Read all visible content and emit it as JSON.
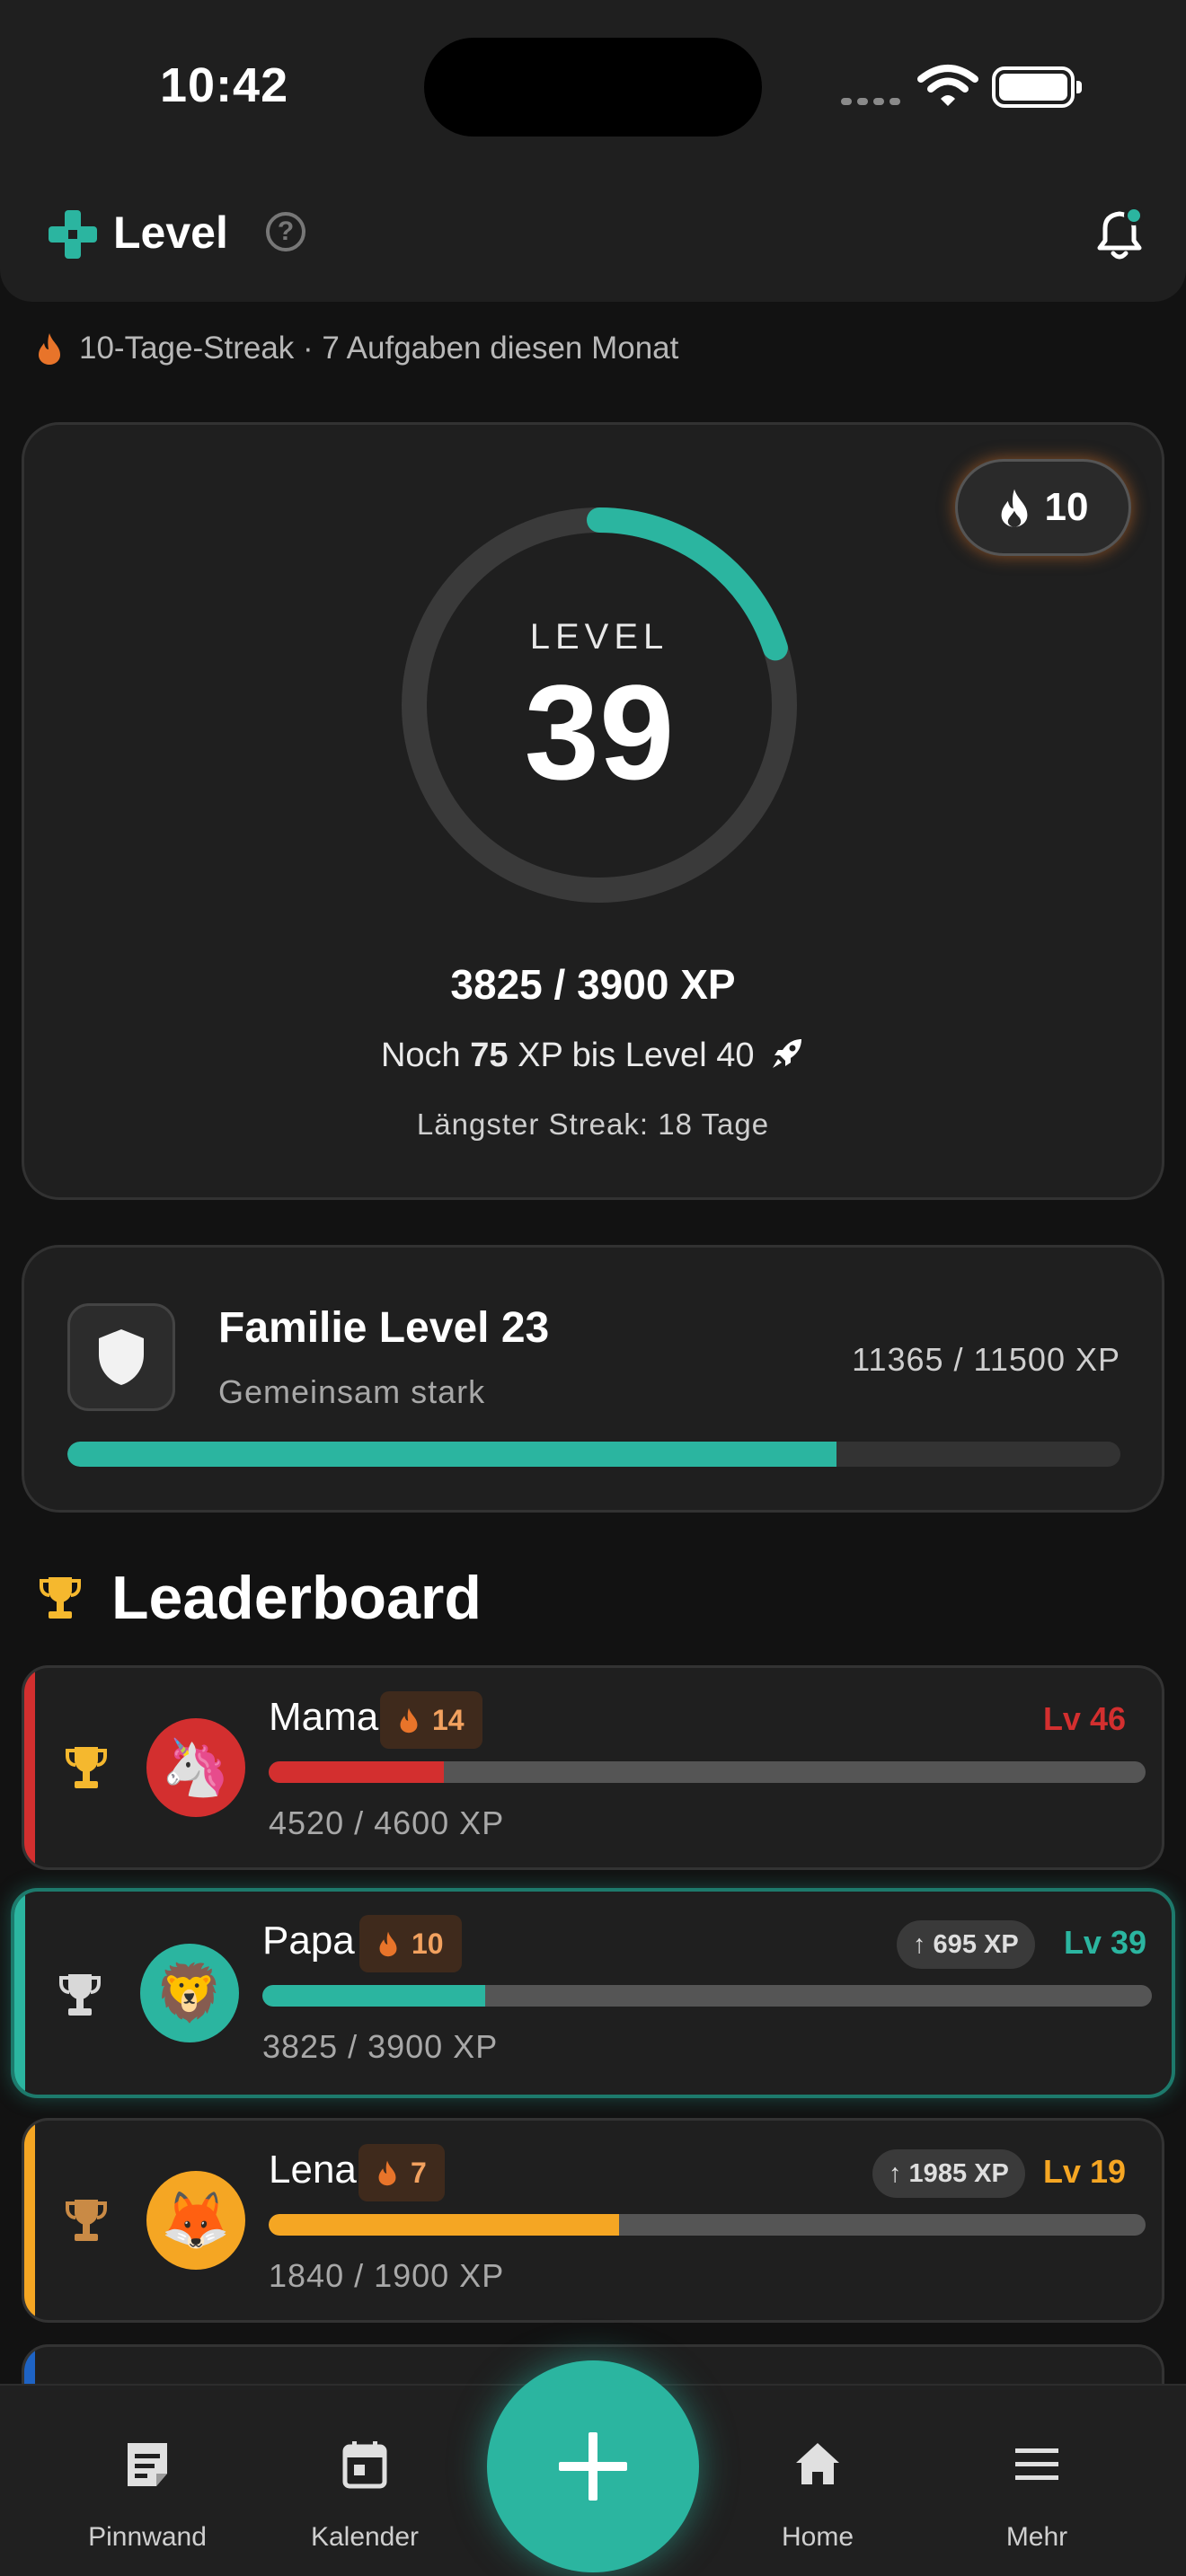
{
  "status_bar": {
    "time": "10:42"
  },
  "header": {
    "title": "Level",
    "help_label": "?"
  },
  "streak_summary": "10-Tage-Streak · 7 Aufgaben diesen Monat",
  "level_card": {
    "ring_label": "LEVEL",
    "level": "39",
    "progress_fraction": 0.2,
    "streak_count": "10",
    "xp_total": "3825 / 3900 XP",
    "xp_remaining_prefix": "Noch",
    "xp_remaining_value": "75",
    "xp_remaining_suffix": "XP bis Level 40",
    "longest_streak": "Längster Streak: 18 Tage"
  },
  "family_card": {
    "title": "Familie Level 23",
    "subtitle": "Gemeinsam stark",
    "xp": "11365 / 11500 XP",
    "progress_percent": 73
  },
  "leaderboard": {
    "title": "Leaderboard",
    "entries": [
      {
        "name": "Mama",
        "streak": "14",
        "level": "Lv 46",
        "xp": "4520 / 4600 XP",
        "progress_percent": 20,
        "color": "#d32f2f",
        "avatar": "🦄",
        "trophy_color": "#f5b82e"
      },
      {
        "name": "Papa",
        "streak": "10",
        "level": "Lv 39",
        "xp": "3825 / 3900 XP",
        "progress_percent": 25,
        "color": "#2bb5a0",
        "avatar": "🦁",
        "up": "↑ 695 XP",
        "trophy_color": "#d8d8d8"
      },
      {
        "name": "Lena",
        "streak": "7",
        "level": "Lv 19",
        "xp": "1840 / 1900 XP",
        "progress_percent": 40,
        "color": "#f5a623",
        "avatar": "🦊",
        "up": "↑ 1985 XP",
        "trophy_color": "#c98a45"
      }
    ]
  },
  "nav": {
    "items": [
      {
        "label": "Pinnwand",
        "icon": "note-icon"
      },
      {
        "label": "Kalender",
        "icon": "calendar-icon"
      },
      {
        "label": "Home",
        "icon": "home-icon"
      },
      {
        "label": "Mehr",
        "icon": "menu-icon"
      }
    ],
    "fab_icon": "plus-icon"
  },
  "colors": {
    "accent": "#2bb5a0",
    "flame": "#e8742a",
    "background": "#121212",
    "card": "#1f1f1f"
  }
}
